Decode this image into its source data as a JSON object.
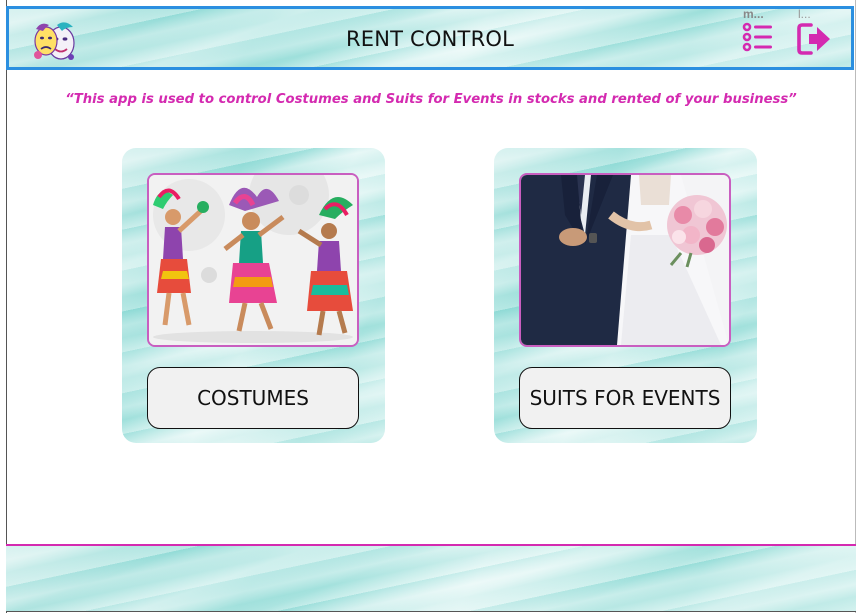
{
  "header": {
    "title": "RENT CONTROL",
    "logo_icon": "theater-masks-logo-icon",
    "menu": {
      "caption": "m...",
      "icon": "list-menu-icon"
    },
    "logout": {
      "caption": "l...",
      "icon": "logout-arrow-icon"
    }
  },
  "description": "“This app is used to control Costumes and Suits for Events in stocks and rented of your business”",
  "cards": [
    {
      "image": "carnival-dancers-illustration",
      "button_label": "COSTUMES"
    },
    {
      "image": "wedding-couple-photo",
      "button_label": "SUITS FOR EVENTS"
    }
  ],
  "colors": {
    "accent_magenta": "#d42ab0",
    "header_border_blue": "#2b8fe0",
    "marble_teal": "#8fdbd6"
  }
}
